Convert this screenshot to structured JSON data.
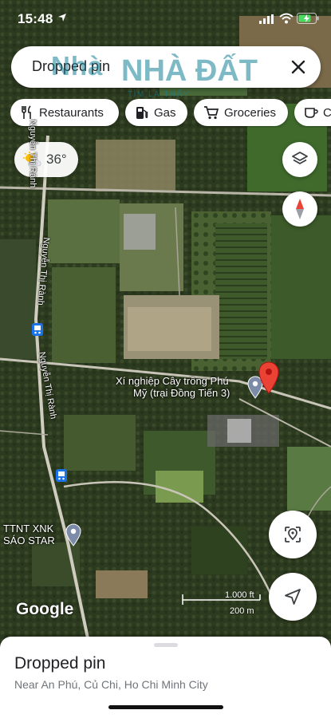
{
  "status_bar": {
    "time": "15:48"
  },
  "search": {
    "query": "Dropped pin",
    "watermark_a": "Nhà",
    "watermark_b": "NHÀ ĐẤT",
    "watermark_c": "TÌM LÀ THẤY"
  },
  "chips": [
    {
      "label": "Restaurants",
      "icon": "restaurant-icon"
    },
    {
      "label": "Gas",
      "icon": "gas-station-icon"
    },
    {
      "label": "Groceries",
      "icon": "cart-icon"
    },
    {
      "label": "C",
      "icon": "coffee-icon"
    }
  ],
  "weather": {
    "temp": "36°",
    "icon": "partly-sunny-icon"
  },
  "map": {
    "place_label_line1": "Xí nghiệp Cây trồng Phú",
    "place_label_line2": "Mỹ (trại Đồng Tiến 3)",
    "road_label_1": "Nguyễn Thị Rành",
    "road_label_2": "Nguyễn Thị Rành",
    "road_label_3": "Nguyễn Thị Rành",
    "poi_line1": "TTNT XNK",
    "poi_line2": "SÁO STAR",
    "google_logo": "Google",
    "scale_ft": "1.000 ft",
    "scale_m": "200 m",
    "pin_color": "#ea4335"
  },
  "sheet": {
    "title": "Dropped pin",
    "subtitle": "Near An Phú, Củ Chi, Ho Chi Minh City"
  }
}
